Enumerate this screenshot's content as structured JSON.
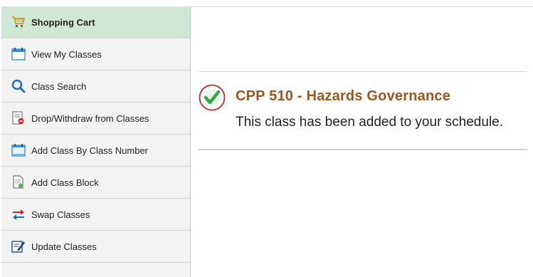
{
  "sidebar": {
    "items": [
      {
        "label": "Shopping Cart",
        "icon": "shopping-cart-icon",
        "active": true
      },
      {
        "label": "View My Classes",
        "icon": "calendar-icon"
      },
      {
        "label": "Class Search",
        "icon": "magnifier-icon"
      },
      {
        "label": "Drop/Withdraw from Classes",
        "icon": "drop-document-icon"
      },
      {
        "label": "Add Class By Class Number",
        "icon": "calendar-add-icon"
      },
      {
        "label": "Add Class Block",
        "icon": "document-block-icon"
      },
      {
        "label": "Swap Classes",
        "icon": "swap-arrows-icon"
      },
      {
        "label": "Update Classes",
        "icon": "edit-document-icon"
      }
    ]
  },
  "message": {
    "course_title": "CPP  510 - Hazards Governance",
    "status_text": "This class has been added to your schedule.",
    "icon": "success-check-icon"
  },
  "colors": {
    "active_nav_bg": "#cfe8d6",
    "course_title": "#a0551e",
    "success_green": "#3aa64a",
    "success_ring": "#d2232a"
  }
}
